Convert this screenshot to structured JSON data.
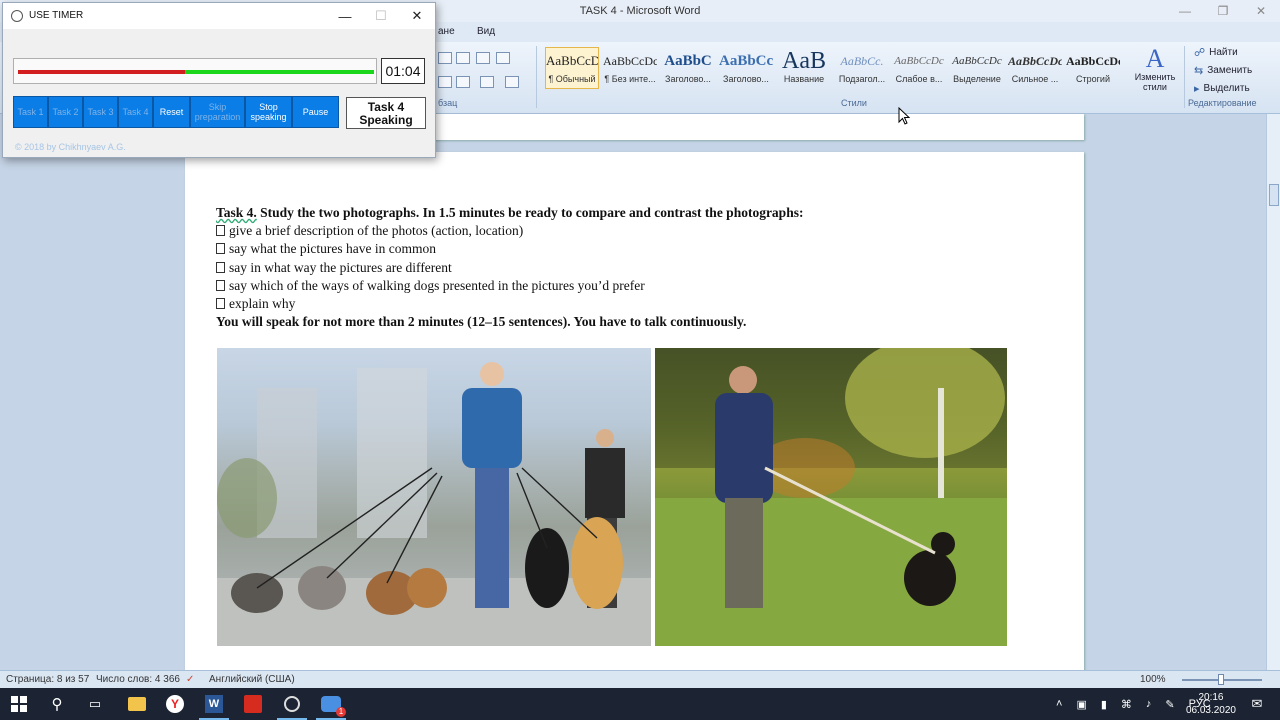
{
  "word": {
    "window_title": "TASK 4 - Microsoft Word",
    "tabs": [
      "ане",
      "Вид"
    ],
    "styles": [
      {
        "preview": "AaBbCcDc",
        "name": "¶ Обычный",
        "active": true
      },
      {
        "preview": "AaBbCcDc",
        "name": "¶ Без инте..."
      },
      {
        "preview": "AaBbC",
        "name": "Заголово..."
      },
      {
        "preview": "AaBbCc",
        "name": "Заголово..."
      },
      {
        "preview": "AaB",
        "name": "Название"
      },
      {
        "preview": "AaBbCc.",
        "name": "Подзагол..."
      },
      {
        "preview": "AaBbCcDc",
        "name": "Слабое в..."
      },
      {
        "preview": "AaBbCcDc",
        "name": "Выделение"
      },
      {
        "preview": "AaBbCcDc",
        "name": "Сильное ..."
      },
      {
        "preview": "AaBbCcDc",
        "name": "Строгий"
      }
    ],
    "group_labels": {
      "paragraph": "бзац",
      "styles": "Стили",
      "editing": "Редактирование"
    },
    "change_styles": "Изменить стили",
    "editing": {
      "find": "Найти",
      "replace": "Заменить",
      "select": "Выделить"
    }
  },
  "document": {
    "heading_prefix": "Task 4.",
    "heading_rest": "Study the two photographs. In 1.5 minutes be ready to compare and contrast the photographs:",
    "bullets": [
      "give a brief description of the photos (action, location)",
      "say what the pictures have in common",
      "say in what way the pictures are different",
      "say which of the ways of walking dogs presented in the pictures you’d prefer",
      "explain why"
    ],
    "footer": "You will speak for not more than 2 minutes (12–15 sentences). You have to talk continuously."
  },
  "status": {
    "page": "Страница: 8 из 57",
    "words": "Число слов: 4 366",
    "language": "Английский (США)",
    "zoom": "100%"
  },
  "timer": {
    "title": "USE TIMER",
    "time": "01:04",
    "progress": 0.47,
    "buttons": [
      {
        "label": "Task 1",
        "state": "dim"
      },
      {
        "label": "Task 2",
        "state": "dim"
      },
      {
        "label": "Task 3",
        "state": "dim"
      },
      {
        "label": "Task 4",
        "state": "dim"
      },
      {
        "label": "Reset",
        "state": "bright"
      },
      {
        "label": "Skip preparation",
        "state": "dim"
      },
      {
        "label": "Stop speaking",
        "state": "bright"
      },
      {
        "label": "Pause",
        "state": "bright"
      }
    ],
    "task_label": "Task 4 Speaking",
    "copyright": "© 2018 by Chikhnyaev A.G."
  },
  "taskbar": {
    "language": "РУС",
    "time": "20:16",
    "date": "06.03.2020",
    "notifications": "1"
  }
}
